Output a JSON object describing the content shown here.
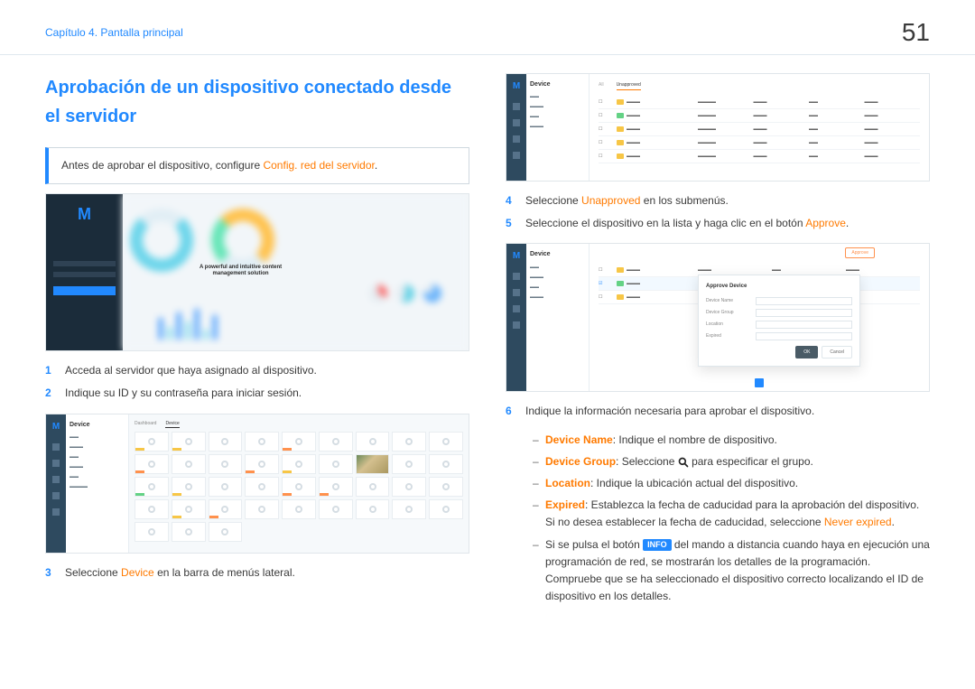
{
  "header": {
    "chapter": "Capítulo 4. Pantalla principal",
    "page_number": "51"
  },
  "left": {
    "title": "Aprobación de un dispositivo conectado desde el servidor",
    "callout_prefix": "Antes de aprobar el dispositivo, configure ",
    "callout_link": "Config. red del servidor",
    "callout_suffix": ".",
    "ss1_caption_line1": "A powerful and intuitive content",
    "ss1_caption_line2": "management solution",
    "step1_num": "1",
    "step1": "Acceda al servidor que haya asignado al dispositivo.",
    "step2_num": "2",
    "step2": "Indique su ID y su contraseña para iniciar sesión.",
    "ss2": {
      "sidebar_title": "Device",
      "tabs": [
        "Dashboard",
        "Device"
      ]
    },
    "step3_num": "3",
    "step3_pre": "Seleccione ",
    "step3_em": "Device",
    "step3_post": " en la barra de menús lateral."
  },
  "right": {
    "ss3": {
      "sidebar_title": "Device",
      "tabs_all": "All",
      "tabs_unapproved": "Unapproved"
    },
    "step4_num": "4",
    "step4_pre": "Seleccione ",
    "step4_em": "Unapproved",
    "step4_post": " en los submenús.",
    "step5_num": "5",
    "step5_pre": "Seleccione el dispositivo en la lista y haga clic en el botón ",
    "step5_em": "Approve",
    "step5_post": ".",
    "ss4": {
      "sidebar_title": "Device",
      "approve_btn": "Approve",
      "modal_title": "Approve Device",
      "field_device_name": "Device Name",
      "field_device_group": "Device Group",
      "field_location": "Location",
      "field_expired": "Expired",
      "btn_ok": "OK",
      "btn_cancel": "Cancel"
    },
    "step6_num": "6",
    "step6": "Indique la información necesaria para aprobar el dispositivo.",
    "sub_devname_label": "Device Name",
    "sub_devname_text": ": Indique el nombre de dispositivo.",
    "sub_devgroup_label": "Device Group",
    "sub_devgroup_pre": ": Seleccione ",
    "sub_devgroup_post": " para especificar el grupo.",
    "sub_location_label": "Location",
    "sub_location_text": ": Indique la ubicación actual del dispositivo.",
    "sub_expired_label": "Expired",
    "sub_expired_pre": ": Establezca la fecha de caducidad para la aprobación del dispositivo. Si no desea establecer la fecha de caducidad, seleccione ",
    "sub_expired_em": "Never expired",
    "sub_expired_post": ".",
    "sub_info_pre": "Si se pulsa el botón ",
    "sub_info_badge": "INFO",
    "sub_info_post": " del mando a distancia cuando haya en ejecución una programación de red, se mostrarán los detalles de la programación. Compruebe que se ha seleccionado el dispositivo correcto localizando el ID de dispositivo en los detalles."
  }
}
